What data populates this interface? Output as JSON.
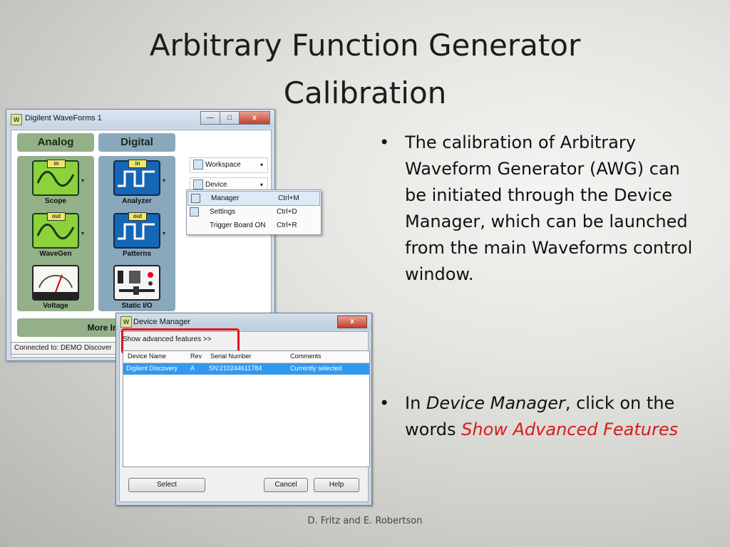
{
  "slide": {
    "title_line1": "Arbitrary Function Generator",
    "title_line2": "Calibration",
    "bullet1": "The calibration of Arbitrary Waveform Generator (AWG) can be initiated through the Device Manager, which can be launched from the main Waveforms control window.",
    "bullet2_prefix": "In ",
    "bullet2_italic": "Device Manager",
    "bullet2_mid": ", click on the words ",
    "bullet2_red": "Show Advanced Features",
    "bullet_marker": "•",
    "footer": "D. Fritz and E. Robertson",
    "accent_red": "#d61c1c"
  },
  "waveforms": {
    "title": "Digilent WaveForms 1",
    "app_icon_glyph": "W",
    "minimize": "—",
    "maximize": "□",
    "close": "x",
    "analog_label": "Analog",
    "digital_label": "Digital",
    "instruments": {
      "scope": "Scope",
      "analyzer": "Analyzer",
      "wavegen": "WaveGen",
      "patterns": "Patterns",
      "voltage": "Voltage",
      "static_io": "Static I/O"
    },
    "tag_in": "in",
    "tag_out": "out",
    "dropdown_glyph": "▾",
    "more_instruments": "More Instrume",
    "status": "Connected to: DEMO Discover",
    "workspace": "Workspace",
    "device": "Device",
    "menu": [
      {
        "label": "Manager",
        "shortcut": "Ctrl+M"
      },
      {
        "label": "Settings",
        "shortcut": "Ctrl+D"
      },
      {
        "label": "Trigger Board ON",
        "shortcut": "Ctrl+R"
      }
    ]
  },
  "device_manager": {
    "title": "Device Manager",
    "close": "x",
    "show_advanced": "Show advanced features >>",
    "columns": [
      "Device Name",
      "Rev",
      "Serial Number",
      "Comments"
    ],
    "row": [
      "Digilent Discovery",
      "A",
      "SN:210244611784",
      "Currently selected"
    ],
    "select": "Select",
    "cancel": "Cancel",
    "help": "Help"
  }
}
